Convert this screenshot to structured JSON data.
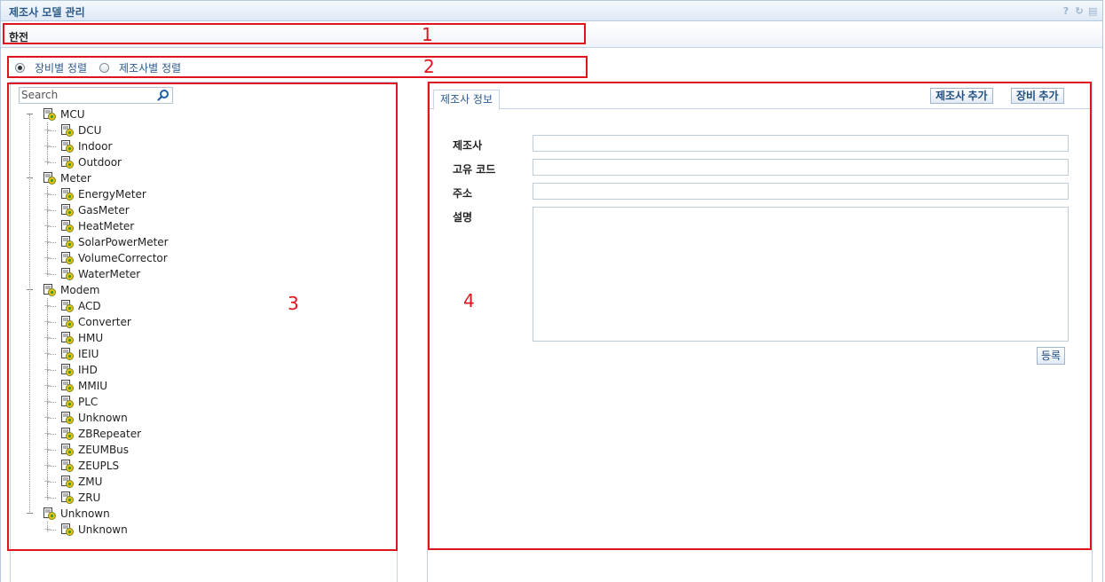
{
  "window": {
    "title": "제조사 모델 관리",
    "tools": [
      "help-icon",
      "refresh-icon",
      "menu-icon"
    ]
  },
  "company": {
    "name": "한전"
  },
  "sort_options": [
    {
      "label": "장비별 정렬",
      "checked": true
    },
    {
      "label": "제조사별 정렬",
      "checked": false
    }
  ],
  "search": {
    "placeholder": "Search"
  },
  "tree": [
    {
      "label": "MCU",
      "children": [
        "DCU",
        "Indoor",
        "Outdoor"
      ]
    },
    {
      "label": "Meter",
      "children": [
        "EnergyMeter",
        "GasMeter",
        "HeatMeter",
        "SolarPowerMeter",
        "VolumeCorrector",
        "WaterMeter"
      ]
    },
    {
      "label": "Modem",
      "children": [
        "ACD",
        "Converter",
        "HMU",
        "IEIU",
        "IHD",
        "MMIU",
        "PLC",
        "Unknown",
        "ZBRepeater",
        "ZEUMBus",
        "ZEUPLS",
        "ZMU",
        "ZRU"
      ]
    },
    {
      "label": "Unknown",
      "children": [
        "Unknown"
      ]
    }
  ],
  "detail": {
    "tab": "제조사 정보",
    "buttons": {
      "add_vendor": "제조사 추가",
      "add_device": "장비 추가"
    },
    "fields": {
      "vendor": "제조사",
      "code": "고유 코드",
      "address": "주소",
      "description": "설명"
    },
    "register": "등록"
  },
  "annotations": [
    "1",
    "2",
    "3",
    "4"
  ]
}
